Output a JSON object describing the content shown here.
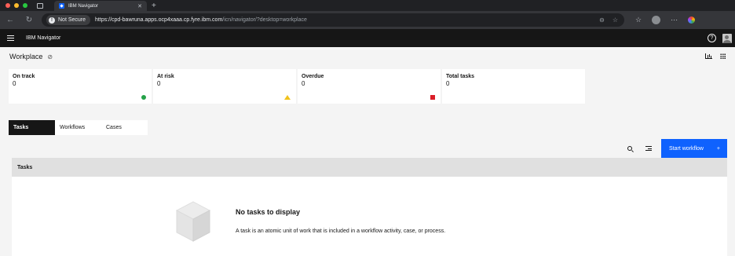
{
  "browser": {
    "tab_title": "IBM Navigator",
    "security_label": "Not Secure",
    "url_host": "https://cpd-bawruna.apps.ocp4xaaa.cp.fyre.ibm.com",
    "url_path": "/icn/navigator/?desktop=workplace",
    "traffic_colors": [
      "#ff5f57",
      "#febc2e",
      "#28c840"
    ]
  },
  "app": {
    "name": "IBM Navigator",
    "help_icon": "help-icon",
    "user_icon": "user-avatar-icon"
  },
  "page": {
    "title": "Workplace"
  },
  "tiles": [
    {
      "label": "On track",
      "count": "0",
      "indicator": "green-circle"
    },
    {
      "label": "At risk",
      "count": "0",
      "indicator": "yellow-triangle"
    },
    {
      "label": "Overdue",
      "count": "0",
      "indicator": "red-square"
    },
    {
      "label": "Total tasks",
      "count": "0",
      "indicator": ""
    }
  ],
  "tabs": [
    {
      "label": "Tasks",
      "active": true
    },
    {
      "label": "Workflows",
      "active": false
    },
    {
      "label": "Cases",
      "active": false
    }
  ],
  "toolbar": {
    "start_workflow_label": "Start workflow",
    "start_workflow_icon": "+"
  },
  "table": {
    "header": "Tasks",
    "empty_title": "No tasks to display",
    "empty_description": "A task is an atomic unit of work that is included in a workflow activity, case, or process."
  },
  "colors": {
    "accent": "#0f62fe",
    "on_track": "#24a148",
    "at_risk": "#f1c21b",
    "overdue": "#da1e28"
  }
}
